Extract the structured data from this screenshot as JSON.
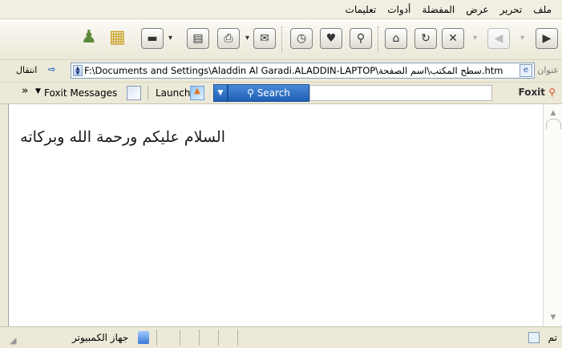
{
  "menu": {
    "items": [
      "ملف",
      "تحرير",
      "عرض",
      "المفضلة",
      "أدوات",
      "تعليمات"
    ]
  },
  "address": {
    "label": "عنوان",
    "go_label": "انتقال",
    "value": "F:\\Documents and Settings\\Aladdin Al Garadi.ALADDIN-LAPTOP\\سطح المكتب\\اسم الصفحة.htm"
  },
  "foxit": {
    "logo_text": "Foxit",
    "search_label": "Search",
    "launch_label": "Launch",
    "messages_label": "Foxit Messages"
  },
  "page": {
    "text": "السلام عليكم ورحمة الله وبركاته"
  },
  "status": {
    "done_label": "تم",
    "zone_label": "جهاز الكمبيوتر"
  }
}
